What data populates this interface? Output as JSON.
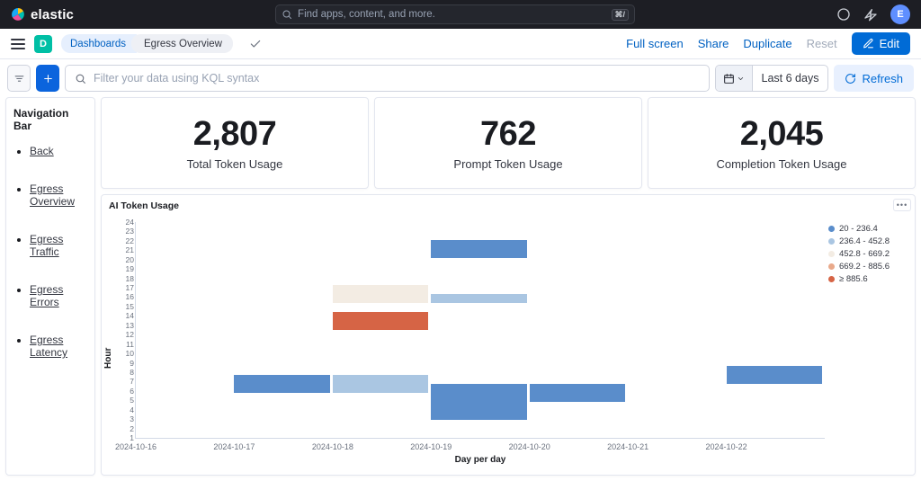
{
  "brand": "elastic",
  "search_placeholder": "Find apps, content, and more.",
  "search_shortcut": "⌘/",
  "avatar_initial": "E",
  "d_badge": "D",
  "breadcrumbs": [
    "Dashboards",
    "Egress Overview"
  ],
  "toolbar_actions": {
    "full_screen": "Full screen",
    "share": "Share",
    "duplicate": "Duplicate",
    "reset": "Reset",
    "edit": "Edit"
  },
  "filter_placeholder": "Filter your data using KQL syntax",
  "date_label": "Last 6 days",
  "refresh_label": "Refresh",
  "sidebar": {
    "title": "Navigation Bar",
    "items": [
      "Back",
      "Egress Overview",
      "Egress Traffic",
      "Egress Errors",
      "Egress Latency"
    ]
  },
  "metrics": [
    {
      "value": "2,807",
      "label": "Total Token Usage"
    },
    {
      "value": "762",
      "label": "Prompt Token Usage"
    },
    {
      "value": "2,045",
      "label": "Completion Token Usage"
    }
  ],
  "chart_data": {
    "type": "heatmap",
    "title": "AI Token Usage",
    "ylabel": "Hour",
    "xlabel": "Day per day",
    "y_values": [
      1,
      2,
      3,
      4,
      5,
      6,
      7,
      8,
      9,
      10,
      11,
      12,
      13,
      14,
      15,
      16,
      17,
      18,
      19,
      20,
      21,
      22,
      23,
      24
    ],
    "x_categories": [
      "2024-10-16",
      "2024-10-17",
      "2024-10-18",
      "2024-10-19",
      "2024-10-20",
      "2024-10-21",
      "2024-10-22"
    ],
    "color_scale": {
      "b0": {
        "label": "20 - 236.4",
        "color": "#5a8dcb"
      },
      "b1": {
        "label": "236.4 - 452.8",
        "color": "#aac6e2"
      },
      "b2": {
        "label": "452.8 - 669.2",
        "color": "#f3ece3"
      },
      "b3": {
        "label": "669.2 - 885.6",
        "color": "#e9a98a"
      },
      "b4": {
        "label": "≥ 885.6",
        "color": "#d66445"
      }
    },
    "cells": [
      {
        "x": "2024-10-17",
        "y": 6,
        "h": 2,
        "bucket": "b0"
      },
      {
        "x": "2024-10-18",
        "y": 6,
        "h": 2,
        "bucket": "b1"
      },
      {
        "x": "2024-10-18",
        "y": 13,
        "h": 2,
        "bucket": "b4"
      },
      {
        "x": "2024-10-18",
        "y": 16,
        "h": 2,
        "bucket": "b2"
      },
      {
        "x": "2024-10-19",
        "y": 3,
        "h": 4,
        "bucket": "b0"
      },
      {
        "x": "2024-10-19",
        "y": 16,
        "h": 1,
        "bucket": "b1"
      },
      {
        "x": "2024-10-19",
        "y": 21,
        "h": 2,
        "bucket": "b0"
      },
      {
        "x": "2024-10-20",
        "y": 5,
        "h": 2,
        "bucket": "b0"
      },
      {
        "x": "2024-10-22",
        "y": 7,
        "h": 2,
        "bucket": "b0"
      }
    ]
  }
}
